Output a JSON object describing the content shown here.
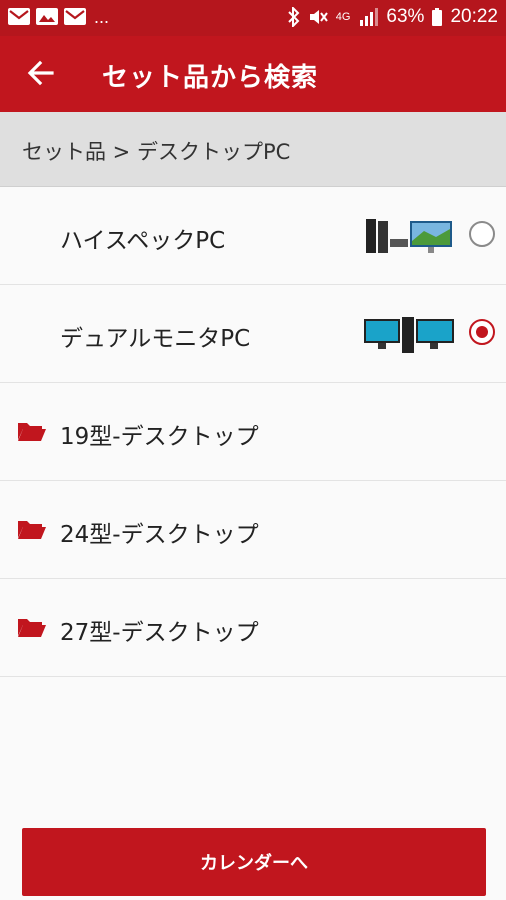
{
  "status_bar": {
    "time": "20:22",
    "battery": "63%",
    "network": "4G",
    "left_icons": [
      "mail-icon",
      "image-icon",
      "mail-icon"
    ],
    "overflow": "..."
  },
  "app_bar": {
    "title": "セット品から検索",
    "back_icon": "arrow-left-icon"
  },
  "breadcrumb": "セット品 > デスクトップPC",
  "items": [
    {
      "label": "ハイスペックPC",
      "type": "radio",
      "selected": false,
      "thumbnail": "tower-with-monitor"
    },
    {
      "label": "デュアルモニタPC",
      "type": "radio",
      "selected": true,
      "thumbnail": "dual-monitor-with-tower"
    },
    {
      "label": "19型-デスクトップ",
      "type": "folder"
    },
    {
      "label": "24型-デスクトップ",
      "type": "folder"
    },
    {
      "label": "27型-デスクトップ",
      "type": "folder"
    }
  ],
  "button": {
    "label": "カレンダーへ"
  },
  "colors": {
    "primary": "#c1161e",
    "status_bar": "#b5161d",
    "breadcrumb_bg": "#dfdfdf"
  }
}
